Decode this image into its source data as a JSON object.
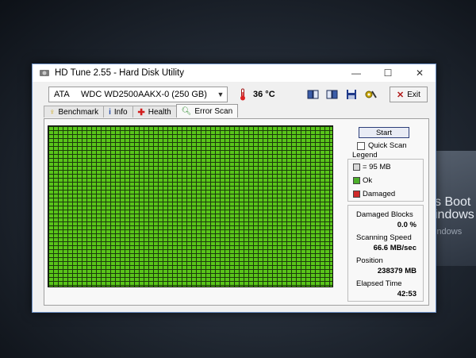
{
  "background": {
    "line1": "s Boot",
    "line2": "indows",
    "line3": "indows"
  },
  "window": {
    "title": "HD Tune 2.55 - Hard Disk Utility",
    "controls": {
      "minimize": "—",
      "maximize": "☐",
      "close": "✕"
    }
  },
  "toolbar": {
    "drive_interface": "ATA",
    "drive_model": "WDC WD2500AAKX-0 (250 GB)",
    "temperature": "36 °C",
    "exit_label": "Exit",
    "buttons": [
      "copy-text-icon",
      "copy-screenshot-icon",
      "save-icon",
      "options-icon"
    ]
  },
  "tabs": [
    {
      "label": "Benchmark",
      "icon": "benchmark-icon"
    },
    {
      "label": "Info",
      "icon": "info-icon"
    },
    {
      "label": "Health",
      "icon": "health-icon"
    },
    {
      "label": "Error Scan",
      "icon": "error-scan-icon"
    }
  ],
  "active_tab": "Error Scan",
  "scan": {
    "start_label": "Start",
    "quick_scan_label": "Quick Scan",
    "quick_scan_checked": false,
    "block_state": "ok"
  },
  "legend": {
    "title": "Legend",
    "block_size": "= 95 MB",
    "ok": "Ok",
    "damaged": "Damaged",
    "colors": {
      "block": "#d8d8d8",
      "ok": "#4caf2a",
      "damaged": "#d02a2a"
    }
  },
  "stats": {
    "damaged_blocks_label": "Damaged Blocks",
    "damaged_blocks_value": "0.0 %",
    "scanning_speed_label": "Scanning Speed",
    "scanning_speed_value": "66.6 MB/sec",
    "position_label": "Position",
    "position_value": "238379 MB",
    "elapsed_label": "Elapsed Time",
    "elapsed_value": "42:53"
  }
}
